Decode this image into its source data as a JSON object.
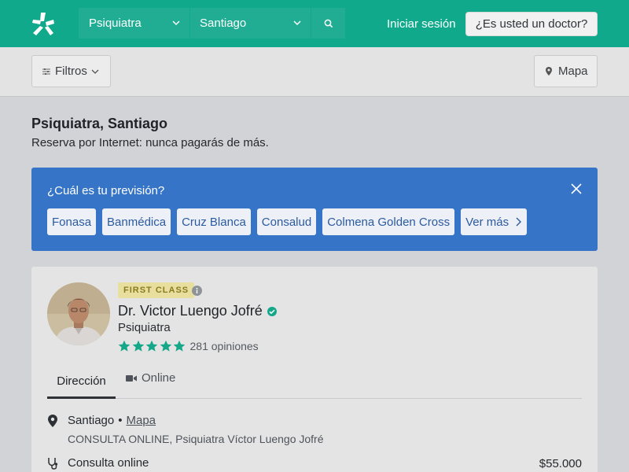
{
  "header": {
    "brand_icon": "doctoralia-logo",
    "search": {
      "specialty": "Psiquiatra",
      "city": "Santiago",
      "search_icon": "search-icon"
    },
    "login_label": "Iniciar sesión",
    "doctor_cta": "¿Es usted un doctor?"
  },
  "toolbar": {
    "filters_label": "Filtros",
    "map_label": "Mapa"
  },
  "page": {
    "title": "Psiquiatra, Santiago",
    "subtitle": "Reserva por Internet: nunca pagarás de más."
  },
  "insurance": {
    "question": "¿Cuál es tu previsión?",
    "options": [
      "Fonasa",
      "Banmédica",
      "Cruz Blanca",
      "Consalud",
      "Colmena Golden Cross"
    ],
    "more_label": "Ver más"
  },
  "doctor": {
    "badge": "FIRST CLASS",
    "name": "Dr. Victor Luengo Jofré",
    "specialty": "Psiquiatra",
    "rating_stars": 5,
    "reviews": "281 opiniones",
    "tabs": {
      "address": "Dirección",
      "online": "Online"
    },
    "location": {
      "city": "Santiago",
      "separator": "•",
      "map_link": "Mapa",
      "detail": "CONSULTA ONLINE, Psiquiatra Víctor Luengo Jofré"
    },
    "service": {
      "name": "Consulta online",
      "price": "$55.000"
    }
  },
  "colors": {
    "brand": "#10a98c",
    "banner": "#3574c6",
    "star": "#14a889"
  }
}
